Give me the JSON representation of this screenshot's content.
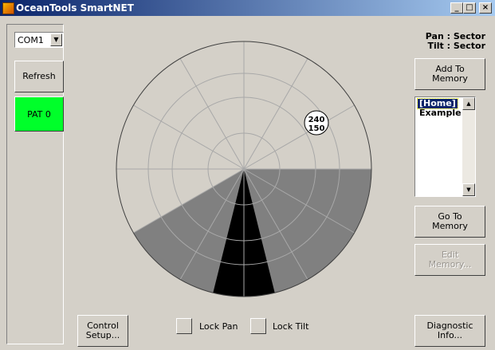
{
  "window": {
    "title": "OceanTools SmartNET",
    "minimize": "_",
    "maximize": "□",
    "close": "×"
  },
  "sidebar": {
    "port": "COM1",
    "port_arrow": "▼",
    "refresh_label": "Refresh",
    "pattern_label": "PAT 0",
    "pattern_color": "#00ff2a"
  },
  "status": {
    "pan": "Pan : Sector",
    "tilt": "Tilt : Sector"
  },
  "memory": {
    "add_label": "Add To\nMemory",
    "items": [
      {
        "label": "[Home]",
        "selected": true
      },
      {
        "label": "Example",
        "selected": false
      }
    ],
    "goto_label": "Go To\nMemory",
    "edit_label": "Edit\nMemory..."
  },
  "bottom": {
    "control_setup_label": "Control\nSetup...",
    "lock_pan_label": "Lock Pan",
    "lock_tilt_label": "Lock Tilt",
    "diagnostic_label": "Diagnostic\nInfo..."
  },
  "radar": {
    "pan_value": "240",
    "tilt_value": "150",
    "colors": {
      "light": "#d4d4d4",
      "mid": "#808080",
      "dark": "#000000",
      "grid": "#a8a8a8"
    }
  },
  "scroll": {
    "up": "▲",
    "down": "▼"
  }
}
